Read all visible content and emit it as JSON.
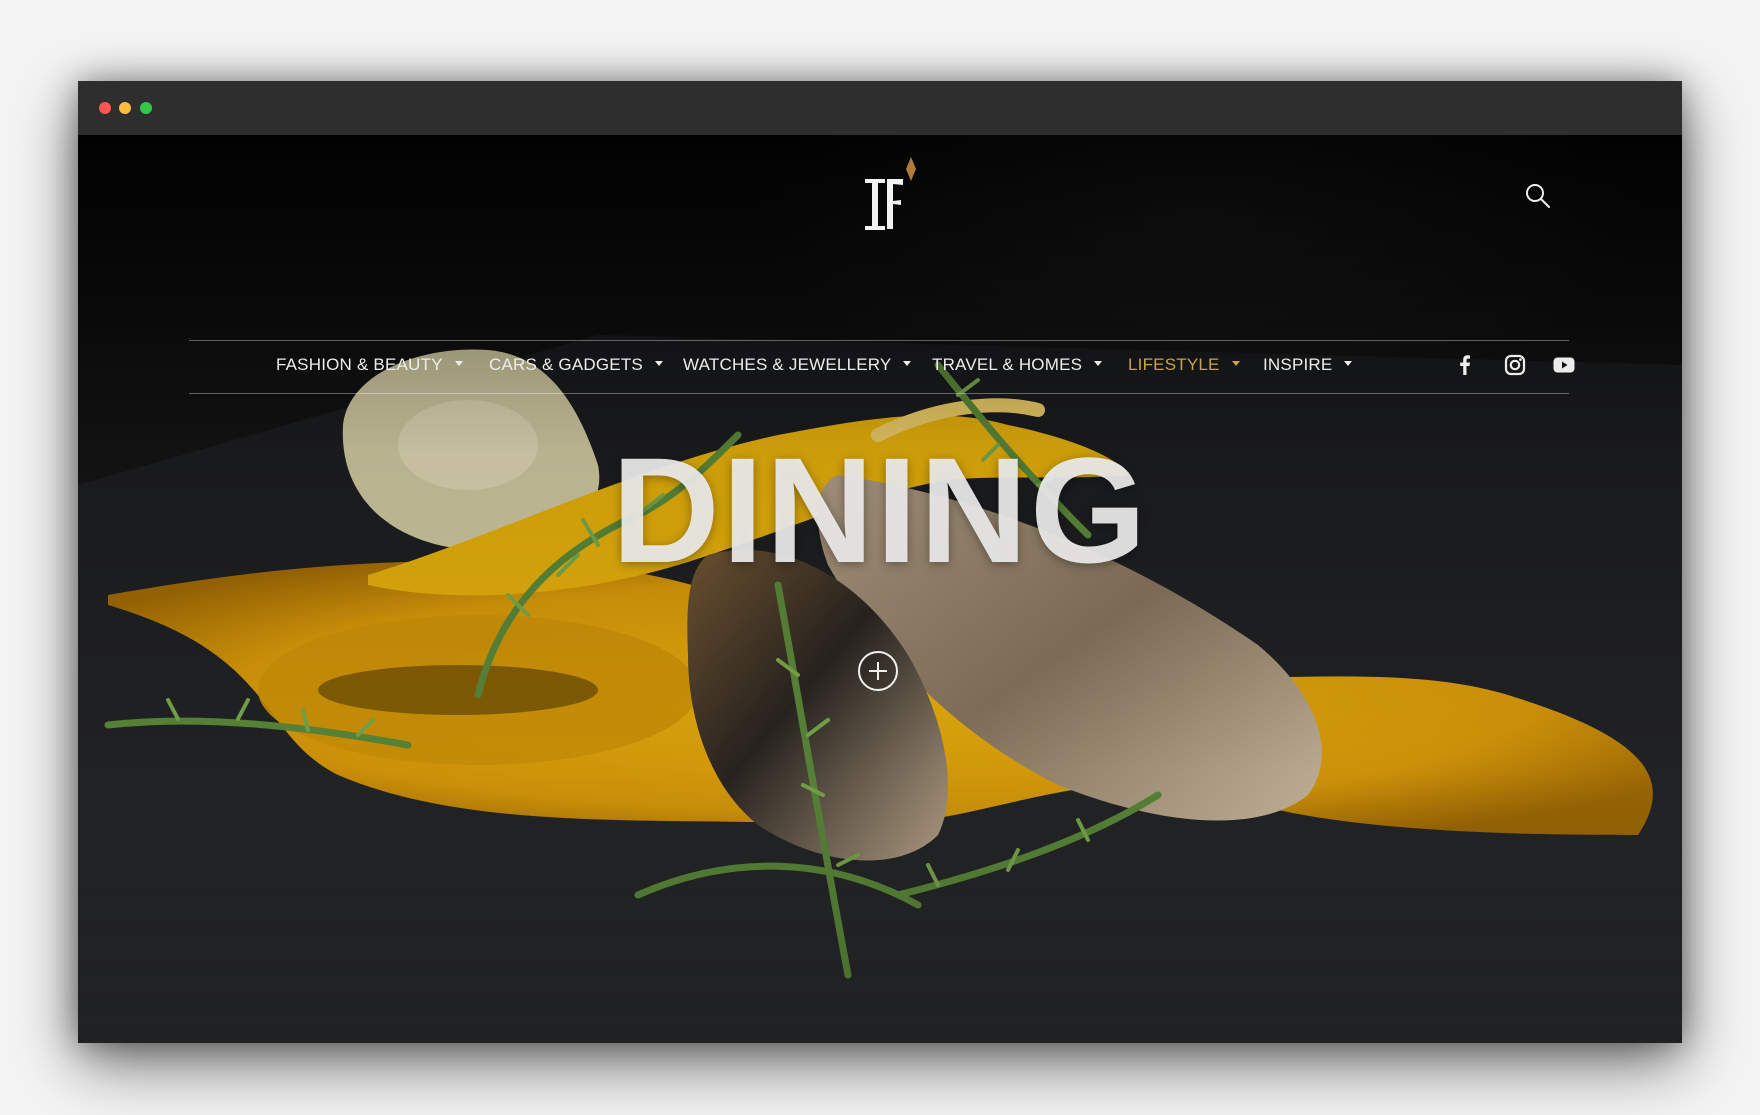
{
  "window": {
    "controls": [
      "close",
      "minimize",
      "maximize"
    ]
  },
  "header": {
    "logo_icon": "F-monogram-logo",
    "logo_accent_color": "#b07a3c",
    "search_icon": "search-icon"
  },
  "nav": {
    "items": [
      {
        "label": "FASHION & BEAUTY",
        "active": false
      },
      {
        "label": "CARS & GADGETS",
        "active": false
      },
      {
        "label": "WATCHES & JEWELLERY",
        "active": false
      },
      {
        "label": "TRAVEL & HOMES",
        "active": false
      },
      {
        "label": "LIFESTYLE",
        "active": true
      },
      {
        "label": "INSPIRE",
        "active": false
      }
    ],
    "active_color": "#c9a24a",
    "social": [
      "facebook-icon",
      "instagram-icon",
      "youtube-icon"
    ]
  },
  "hero": {
    "title": "DINING",
    "expand_icon": "plus-circle-icon"
  }
}
